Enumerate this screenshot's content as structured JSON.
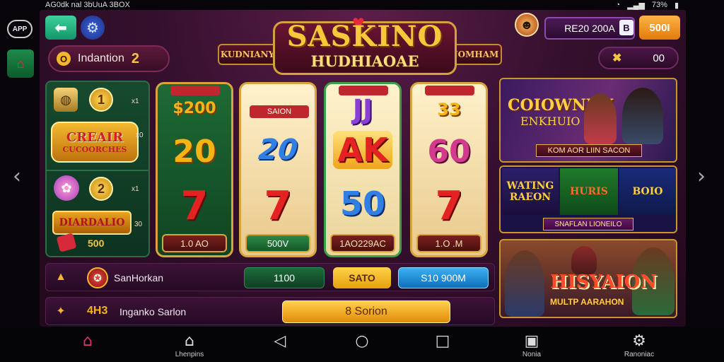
{
  "status_bar": {
    "left": "AG0dk nal 3bUuA 3BOX",
    "battery": "73%"
  },
  "rail": {
    "app_label": "APP",
    "prev_icon": "chevron-left-icon",
    "next_icon": "chevron-right-icon"
  },
  "header": {
    "logo_title": "SASKINO",
    "logo_subtitle": "HUDHIAOAE",
    "ribbon_left": "KUDNIANY",
    "ribbon_right": "NOMHAM",
    "level_label": "Indantion",
    "level_num": "2",
    "level_badge": "O",
    "balance": "RE20 200A",
    "buy_label": "500I",
    "coins_value": "00"
  },
  "rewards": {
    "coin1": "1",
    "coin2": "2",
    "mult1": "x1",
    "mult2": "x0",
    "mult3": "x1",
    "mult4": "30",
    "banner1_line1": "CREAIR",
    "banner1_line2": "CUCOORCHES",
    "banner2": "DIARDALIO",
    "value": "500"
  },
  "reels": [
    {
      "tag": "",
      "top": "$200",
      "mid": "20",
      "bottom": "7",
      "footer": "1.0 AO"
    },
    {
      "tag": "SAION",
      "top": "",
      "mid": "20",
      "bottom": "7",
      "footer": "500V"
    },
    {
      "tag": "",
      "top": "JJ",
      "mid": "AK",
      "bottom": "50",
      "footer": "1AO229AC"
    },
    {
      "tag": "",
      "top": "33",
      "mid": "60",
      "bottom": "7",
      "footer": "1.O .M"
    }
  ],
  "promos": {
    "p1_title": "COIOWNUN",
    "p1_sub": "ENKHUIO",
    "p1_bar": "KOM AOR LIIN SACON",
    "p2_tile1": "WATING RAEON",
    "p2_tile2": "HURIS",
    "p2_tile3": "BOIO",
    "p2_bar": "SNAFLAN LIONEILO",
    "p3_title": "HISYAION",
    "p3_sub": "MULTP AARAHON"
  },
  "controls": {
    "row1_label": "SanHorkan",
    "bet_value": "1100",
    "max_label": "SATO",
    "win_value": "S10 900M",
    "row2_tag": "4H3",
    "row2_label": "Inganko Sarlon",
    "spin_label": "8 Sorion"
  },
  "bottom_nav": [
    {
      "icon": "casino-icon",
      "label": ""
    },
    {
      "icon": "home-icon",
      "label": "Lhenpins"
    },
    {
      "icon": "back-icon",
      "label": ""
    },
    {
      "icon": "home-circle-icon",
      "label": ""
    },
    {
      "icon": "recents-icon",
      "label": ""
    },
    {
      "icon": "notes-icon",
      "label": "Nonia"
    },
    {
      "icon": "settings-icon",
      "label": "Ranoniac"
    }
  ],
  "colors": {
    "brand_gold": "#f5c542",
    "purple_bg": "#35102e",
    "green_panel": "#164a2e"
  }
}
